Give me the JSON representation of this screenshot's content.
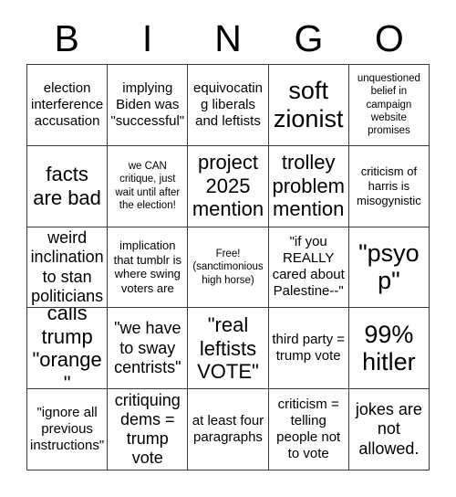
{
  "card": {
    "title": "BINGO",
    "columns": [
      "B",
      "I",
      "N",
      "G",
      "O"
    ],
    "colors": {
      "text": "#000000",
      "grid_line": "#3a3a3a",
      "background": "#ffffff"
    },
    "cells": [
      [
        {
          "text": "election interference accusation",
          "size": "md"
        },
        {
          "text": "implying Biden was \"successful\"",
          "size": "md"
        },
        {
          "text": "equivocating liberals and leftists",
          "size": "md"
        },
        {
          "text": "soft zionist",
          "size": "xxl"
        },
        {
          "text": "unquestioned belief in campaign website promises",
          "size": "xs"
        }
      ],
      [
        {
          "text": "facts are bad",
          "size": "xl"
        },
        {
          "text": "we CAN critique, just wait until after the election!",
          "size": "xs"
        },
        {
          "text": "project 2025 mention",
          "size": "xl"
        },
        {
          "text": "trolley problem mention",
          "size": "xl"
        },
        {
          "text": "criticism of harris is misogynistic",
          "size": "sm"
        }
      ],
      [
        {
          "text": "weird inclination to stan politicians",
          "size": "lg"
        },
        {
          "text": "implication that tumblr is where swing voters are",
          "size": "sm"
        },
        {
          "text": "Free! (sanctimonious high horse)",
          "size": "xs"
        },
        {
          "text": "\"if you REALLY cared about Palestine--\"",
          "size": "md"
        },
        {
          "text": "\"psyop\"",
          "size": "xxl"
        }
      ],
      [
        {
          "text": "calls trump \"orange\"",
          "size": "xl"
        },
        {
          "text": "\"we have to sway centrists\"",
          "size": "lg"
        },
        {
          "text": "\"real leftists VOTE\"",
          "size": "xl"
        },
        {
          "text": "third party = trump vote",
          "size": "md"
        },
        {
          "text": "99% hitler",
          "size": "xxl"
        }
      ],
      [
        {
          "text": "\"ignore all previous instructions\"",
          "size": "md"
        },
        {
          "text": "critiquing dems = trump vote",
          "size": "lg"
        },
        {
          "text": "at least four paragraphs",
          "size": "md"
        },
        {
          "text": "criticism = telling people not to vote",
          "size": "md"
        },
        {
          "text": "jokes are not allowed.",
          "size": "lg"
        }
      ]
    ]
  }
}
